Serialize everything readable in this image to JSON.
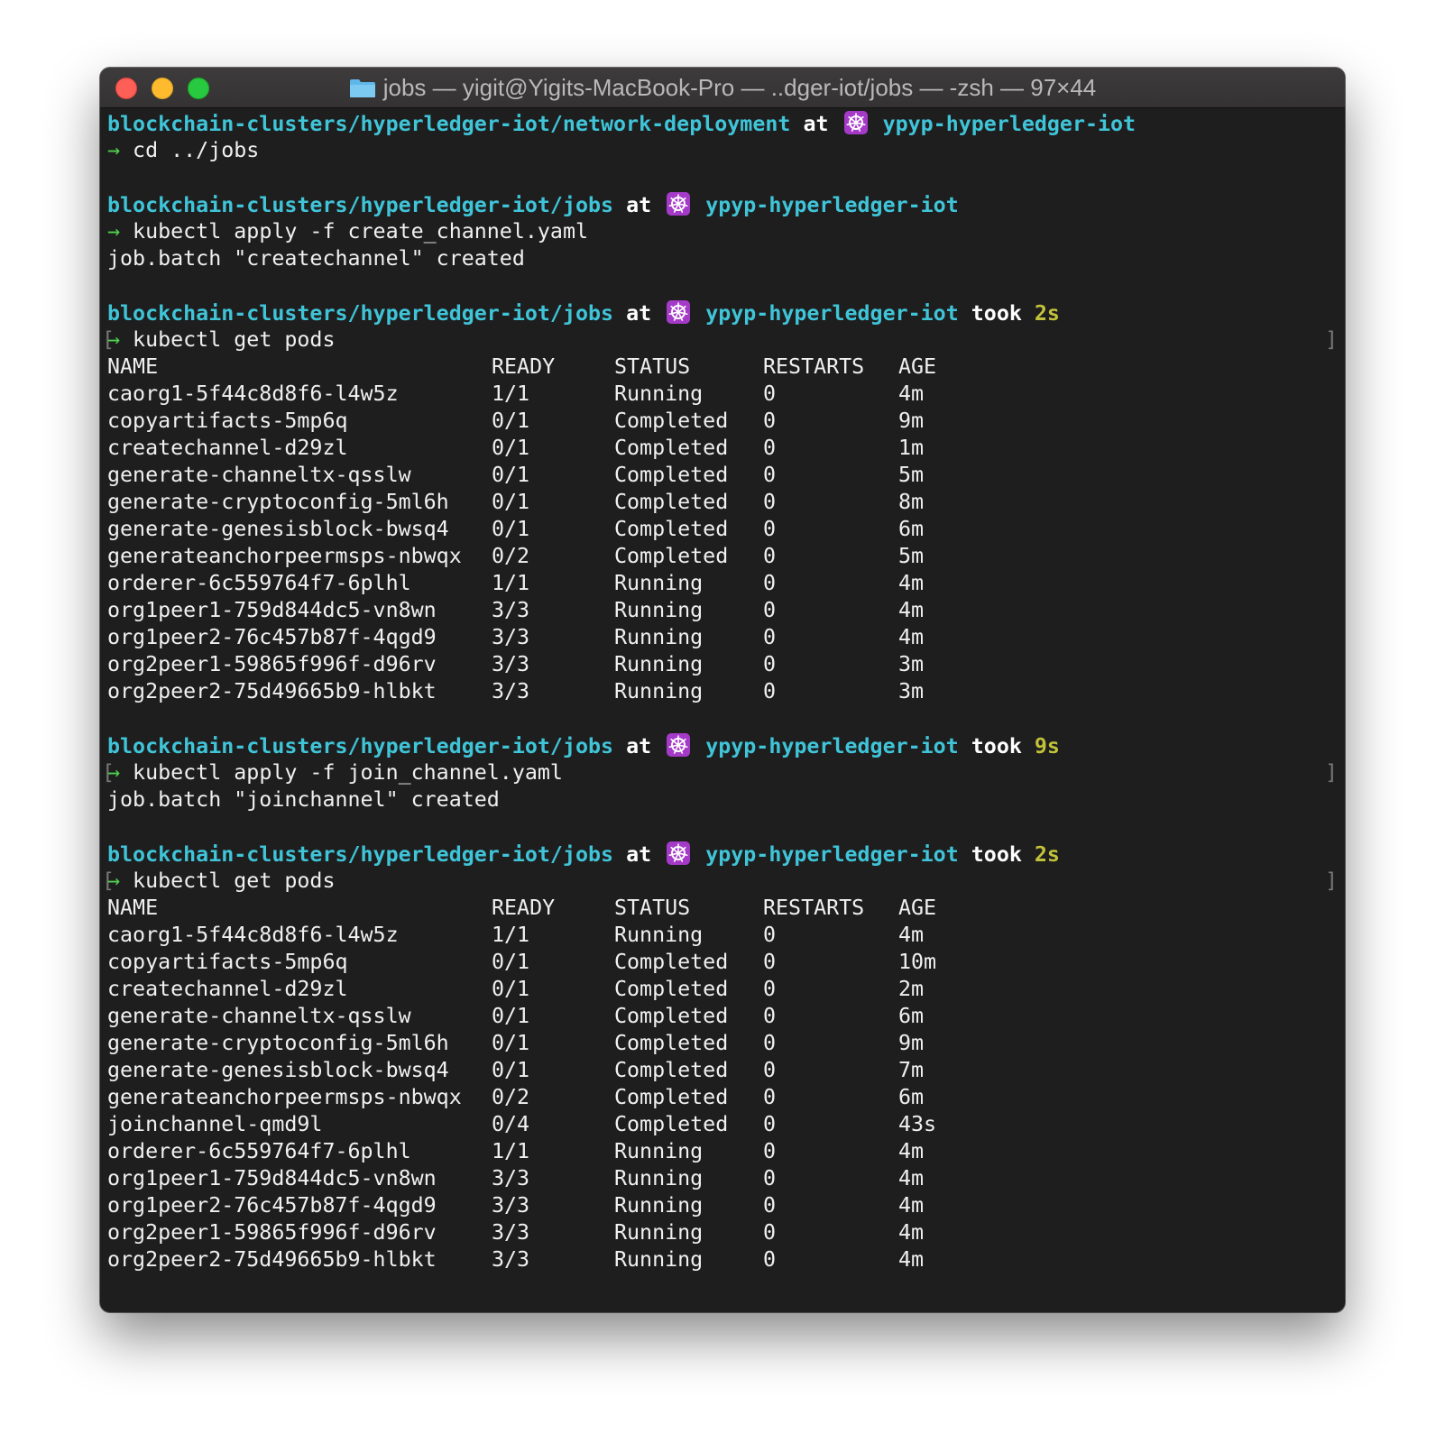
{
  "window": {
    "title": "jobs — yigit@Yigits-MacBook-Pro — ..dger-iot/jobs — -zsh — 97×44"
  },
  "terminal": {
    "blocks": [
      {
        "prompt": {
          "path": "blockchain-clusters/hyperledger-iot/network-deployment",
          "at": "at",
          "context": "ypyp-hyperledger-iot"
        },
        "command": "→ cd ../jobs"
      },
      {
        "prompt": {
          "path": "blockchain-clusters/hyperledger-iot/jobs",
          "at": "at",
          "context": "ypyp-hyperledger-iot"
        },
        "command": "→ kubectl apply -f create_channel.yaml",
        "output": "job.batch \"createchannel\" created"
      },
      {
        "prompt": {
          "path": "blockchain-clusters/hyperledger-iot/jobs",
          "at": "at",
          "context": "ypyp-hyperledger-iot",
          "took": "took",
          "took_value": "2s"
        },
        "command": "→ kubectl get pods",
        "table": {
          "headers": [
            "NAME",
            "READY",
            "STATUS",
            "RESTARTS",
            "AGE"
          ],
          "rows": [
            [
              "caorg1-5f44c8d8f6-l4w5z",
              "1/1",
              "Running",
              "0",
              "4m"
            ],
            [
              "copyartifacts-5mp6q",
              "0/1",
              "Completed",
              "0",
              "9m"
            ],
            [
              "createchannel-d29zl",
              "0/1",
              "Completed",
              "0",
              "1m"
            ],
            [
              "generate-channeltx-qsslw",
              "0/1",
              "Completed",
              "0",
              "5m"
            ],
            [
              "generate-cryptoconfig-5ml6h",
              "0/1",
              "Completed",
              "0",
              "8m"
            ],
            [
              "generate-genesisblock-bwsq4",
              "0/1",
              "Completed",
              "0",
              "6m"
            ],
            [
              "generateanchorpeermsps-nbwqx",
              "0/2",
              "Completed",
              "0",
              "5m"
            ],
            [
              "orderer-6c559764f7-6plhl",
              "1/1",
              "Running",
              "0",
              "4m"
            ],
            [
              "org1peer1-759d844dc5-vn8wn",
              "3/3",
              "Running",
              "0",
              "4m"
            ],
            [
              "org1peer2-76c457b87f-4qgd9",
              "3/3",
              "Running",
              "0",
              "4m"
            ],
            [
              "org2peer1-59865f996f-d96rv",
              "3/3",
              "Running",
              "0",
              "3m"
            ],
            [
              "org2peer2-75d49665b9-hlbkt",
              "3/3",
              "Running",
              "0",
              "3m"
            ]
          ]
        }
      },
      {
        "prompt": {
          "path": "blockchain-clusters/hyperledger-iot/jobs",
          "at": "at",
          "context": "ypyp-hyperledger-iot",
          "took": "took",
          "took_value": "9s"
        },
        "command": "→ kubectl apply -f join_channel.yaml",
        "output": "job.batch \"joinchannel\" created"
      },
      {
        "prompt": {
          "path": "blockchain-clusters/hyperledger-iot/jobs",
          "at": "at",
          "context": "ypyp-hyperledger-iot",
          "took": "took",
          "took_value": "2s"
        },
        "command": "→ kubectl get pods",
        "table": {
          "headers": [
            "NAME",
            "READY",
            "STATUS",
            "RESTARTS",
            "AGE"
          ],
          "rows": [
            [
              "caorg1-5f44c8d8f6-l4w5z",
              "1/1",
              "Running",
              "0",
              "4m"
            ],
            [
              "copyartifacts-5mp6q",
              "0/1",
              "Completed",
              "0",
              "10m"
            ],
            [
              "createchannel-d29zl",
              "0/1",
              "Completed",
              "0",
              "2m"
            ],
            [
              "generate-channeltx-qsslw",
              "0/1",
              "Completed",
              "0",
              "6m"
            ],
            [
              "generate-cryptoconfig-5ml6h",
              "0/1",
              "Completed",
              "0",
              "9m"
            ],
            [
              "generate-genesisblock-bwsq4",
              "0/1",
              "Completed",
              "0",
              "7m"
            ],
            [
              "generateanchorpeermsps-nbwqx",
              "0/2",
              "Completed",
              "0",
              "6m"
            ],
            [
              "joinchannel-qmd9l",
              "0/4",
              "Completed",
              "0",
              "43s"
            ],
            [
              "orderer-6c559764f7-6plhl",
              "1/1",
              "Running",
              "0",
              "4m"
            ],
            [
              "org1peer1-759d844dc5-vn8wn",
              "3/3",
              "Running",
              "0",
              "4m"
            ],
            [
              "org1peer2-76c457b87f-4qgd9",
              "3/3",
              "Running",
              "0",
              "4m"
            ],
            [
              "org2peer1-59865f996f-d96rv",
              "3/3",
              "Running",
              "0",
              "4m"
            ],
            [
              "org2peer2-75d49665b9-hlbkt",
              "3/3",
              "Running",
              "0",
              "4m"
            ]
          ]
        }
      }
    ]
  },
  "icons": {
    "folder": "folder-icon",
    "kubernetes": "kubernetes-helm-icon"
  },
  "colors": {
    "background": "#1e1e1e",
    "path": "#3fc4d8",
    "arrow": "#4ed04e",
    "took_value": "#c2c23a",
    "kubernetes_badge": "#a53ac9"
  }
}
